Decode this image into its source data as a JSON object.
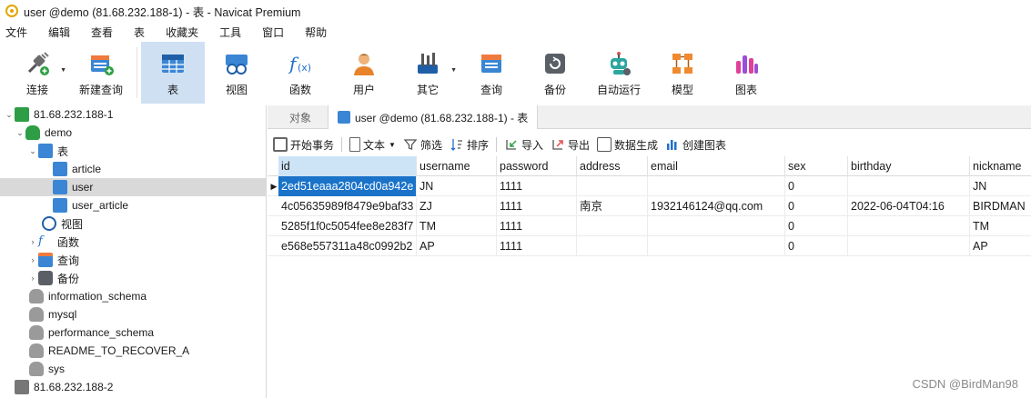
{
  "window": {
    "title": "user @demo (81.68.232.188-1) - 表 - Navicat Premium"
  },
  "menu": [
    "文件",
    "编辑",
    "查看",
    "表",
    "收藏夹",
    "工具",
    "窗口",
    "帮助"
  ],
  "toolbar": {
    "buttons": [
      {
        "label": "连接",
        "icon": "plug-connect-icon"
      },
      {
        "label": "新建查询",
        "icon": "new-query-icon"
      },
      {
        "label": "表",
        "icon": "table-icon"
      },
      {
        "label": "视图",
        "icon": "view-glasses-icon"
      },
      {
        "label": "函数",
        "icon": "function-fx-icon"
      },
      {
        "label": "用户",
        "icon": "user-icon"
      },
      {
        "label": "其它",
        "icon": "other-tools-icon"
      },
      {
        "label": "查询",
        "icon": "query-icon"
      },
      {
        "label": "备份",
        "icon": "backup-icon"
      },
      {
        "label": "自动运行",
        "icon": "robot-icon"
      },
      {
        "label": "模型",
        "icon": "model-icon"
      },
      {
        "label": "图表",
        "icon": "chart-icon"
      }
    ]
  },
  "nav": {
    "items": [
      {
        "label": "81.68.232.188-1"
      },
      {
        "label": "demo"
      },
      {
        "label": "表"
      },
      {
        "label": "article"
      },
      {
        "label": "user"
      },
      {
        "label": "user_article"
      },
      {
        "label": "视图"
      },
      {
        "label": "函数"
      },
      {
        "label": "查询"
      },
      {
        "label": "备份"
      },
      {
        "label": "information_schema"
      },
      {
        "label": "mysql"
      },
      {
        "label": "performance_schema"
      },
      {
        "label": "README_TO_RECOVER_A"
      },
      {
        "label": "sys"
      },
      {
        "label": "81.68.232.188-2"
      }
    ]
  },
  "tabs": {
    "objects": "对象",
    "active": "user @demo (81.68.232.188-1) - 表"
  },
  "objbar": {
    "begin_tx": "开始事务",
    "text": "文本",
    "filter": "筛选",
    "sort": "排序",
    "import": "导入",
    "export": "导出",
    "generate": "数据生成",
    "create_chart": "创建图表"
  },
  "grid": {
    "columns": [
      "id",
      "username",
      "password",
      "address",
      "email",
      "sex",
      "birthday",
      "nickname"
    ],
    "rows": [
      [
        "2ed51eaaa2804cd0a942e",
        "JN",
        "1111",
        "",
        "",
        "0",
        "",
        "JN"
      ],
      [
        "4c05635989f8479e9baf33",
        "ZJ",
        "1111",
        "南京",
        "1932146124@qq.com",
        "0",
        "2022-06-04T04:16",
        "BIRDMAN"
      ],
      [
        "5285f1f0c5054fee8e283f7",
        "TM",
        "1111",
        "",
        "",
        "0",
        "",
        "TM"
      ],
      [
        "e568e557311a48c0992b2",
        "AP",
        "1111",
        "",
        "",
        "0",
        "",
        "AP"
      ]
    ]
  },
  "watermark": "CSDN @BirdMan98"
}
